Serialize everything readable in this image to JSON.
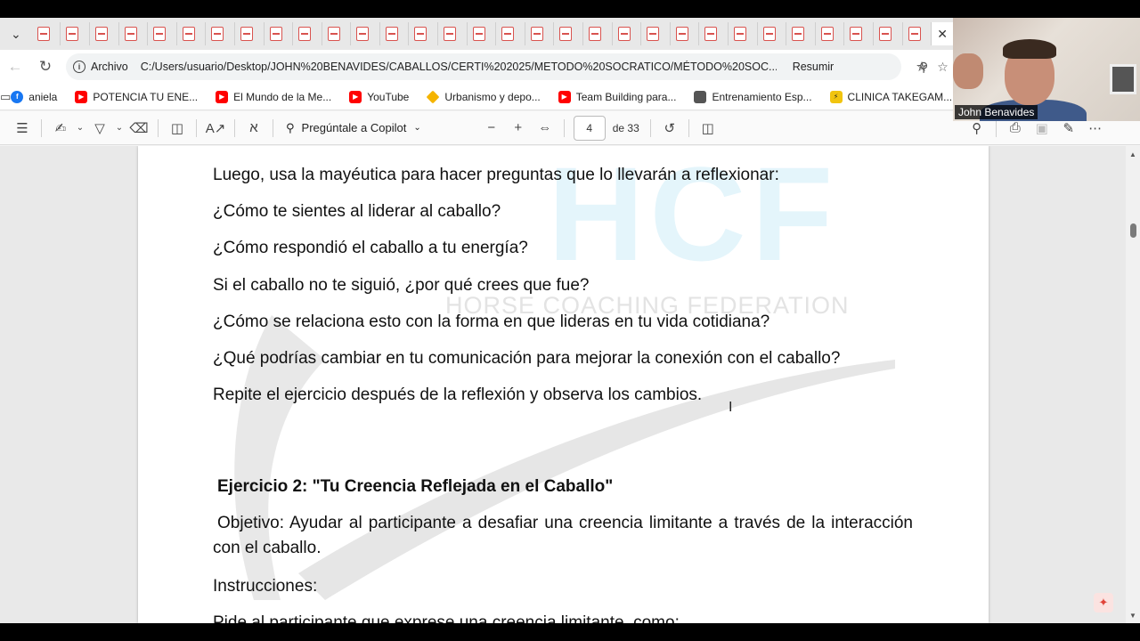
{
  "tabs": {
    "count": 31
  },
  "address": {
    "site_label": "Archivo",
    "url": "C:/Users/usuario/Desktop/JOHN%20BENAVIDES/CABALLOS/CERTI%202025/METODO%20SOCRATICO/MÉTODO%20SOC...",
    "resumir": "Resumir"
  },
  "bookmarks": [
    {
      "label": "aniela",
      "icon": "facebook-icon"
    },
    {
      "label": "POTENCIA TU ENE...",
      "icon": "youtube-icon"
    },
    {
      "label": "El Mundo de la Me...",
      "icon": "youtube-icon"
    },
    {
      "label": "YouTube",
      "icon": "youtube-icon"
    },
    {
      "label": "Urbanismo y depo...",
      "icon": "star-icon"
    },
    {
      "label": "Team Building para...",
      "icon": "youtube-icon"
    },
    {
      "label": "Entrenamiento Esp...",
      "icon": "grid-icon"
    },
    {
      "label": "CLINICA TAKEGAM...",
      "icon": "bolt-icon"
    }
  ],
  "pdf_toolbar": {
    "copilot_label": "Pregúntale a Copilot",
    "current_page": "4",
    "of_pages": "de 33"
  },
  "webcam": {
    "name": "John Benavides"
  },
  "watermark": {
    "logo_text": "HCF",
    "org": "HORSE COACHING FEDERATION"
  },
  "document": {
    "lines": [
      "Luego, usa la mayéutica para hacer preguntas que lo llevarán a reflexionar:",
      "¿Cómo te sientes al liderar al caballo?",
      "¿Cómo respondió el caballo a tu energía?",
      "Si el caballo no te siguió, ¿por qué crees que fue?",
      "¿Cómo se relaciona esto con la forma en que lideras en tu vida cotidiana?",
      "¿Qué podrías cambiar en tu comunicación para mejorar la conexión con el caballo?",
      "Repite el ejercicio después de la reflexión y observa los cambios."
    ],
    "heading": "Ejercicio 2: \"Tu Creencia Reflejada en el Caballo\"",
    "objective": "Objetivo: Ayudar al participante a desafiar una creencia limitante a través de la interacción con el caballo.",
    "instructions": "Instrucciones:",
    "last_line": "Pide al participante que exprese una creencia limitante, como:"
  },
  "colors": {
    "watermark_blue": "#e4f5fb",
    "pdf_red": "#d9534f",
    "accent_gray": "#7a7a7a"
  }
}
